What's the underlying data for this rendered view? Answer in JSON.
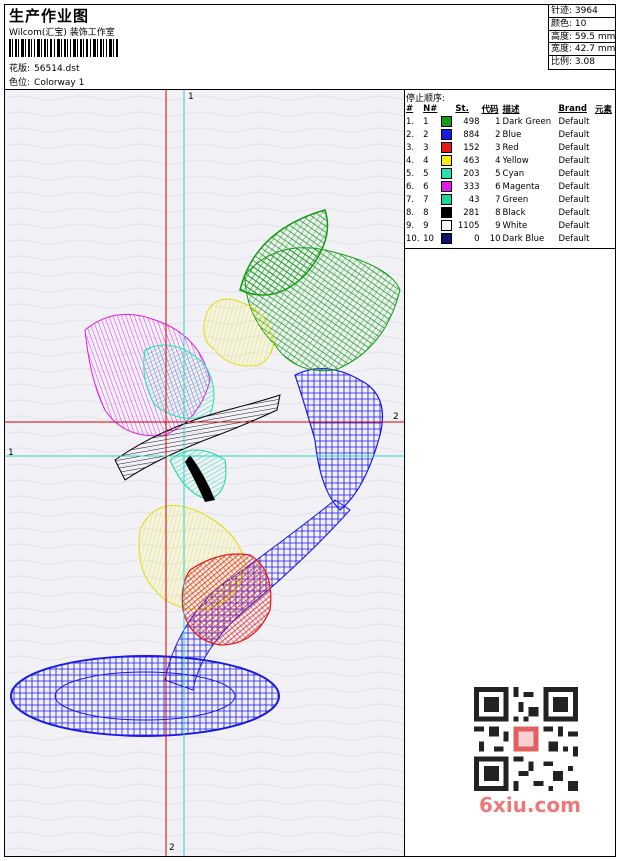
{
  "header": {
    "title": "生产作业图",
    "company": "Wilcom(汇宝) 装饰工作室",
    "design_label": "花版:",
    "design_value": "56514.dst",
    "colorway_label": "色位:",
    "colorway_value": "Colorway 1"
  },
  "stats": [
    {
      "label": "针迹:",
      "value": "3964"
    },
    {
      "label": "颜色:",
      "value": "10"
    },
    {
      "label": "高度:",
      "value": "59.5 mm"
    },
    {
      "label": "宽度:",
      "value": "42.7 mm"
    },
    {
      "label": "比例:",
      "value": "3.08"
    }
  ],
  "axes": {
    "top_marker": "1",
    "left_marker": "1",
    "right_marker": "2",
    "bottom_marker": "2"
  },
  "legend": {
    "title": "停止顺序:",
    "headers": [
      "#",
      "N#",
      "St.",
      "代码",
      "描述",
      "Brand",
      "元素"
    ],
    "rows": [
      {
        "idx": "1.",
        "n": "1",
        "color": "#129e12",
        "st": "498",
        "code": "1",
        "desc": "Dark Green",
        "brand": "Default"
      },
      {
        "idx": "2.",
        "n": "2",
        "color": "#1a1ae8",
        "st": "884",
        "code": "2",
        "desc": "Blue",
        "brand": "Default"
      },
      {
        "idx": "3.",
        "n": "3",
        "color": "#e81818",
        "st": "152",
        "code": "3",
        "desc": "Red",
        "brand": "Default"
      },
      {
        "idx": "4.",
        "n": "4",
        "color": "#f2ee12",
        "st": "463",
        "code": "4",
        "desc": "Yellow",
        "brand": "Default"
      },
      {
        "idx": "5.",
        "n": "5",
        "color": "#22e2b4",
        "st": "203",
        "code": "5",
        "desc": "Cyan",
        "brand": "Default"
      },
      {
        "idx": "6.",
        "n": "6",
        "color": "#e61ae6",
        "st": "333",
        "code": "6",
        "desc": "Magenta",
        "brand": "Default"
      },
      {
        "idx": "7.",
        "n": "7",
        "color": "#1ad89c",
        "st": "43",
        "code": "7",
        "desc": "Green",
        "brand": "Default"
      },
      {
        "idx": "8.",
        "n": "8",
        "color": "#000000",
        "st": "281",
        "code": "8",
        "desc": "Black",
        "brand": "Default"
      },
      {
        "idx": "9.",
        "n": "9",
        "color": "#f4f4f4",
        "st": "1105",
        "code": "9",
        "desc": "White",
        "brand": "Default"
      },
      {
        "idx": "10.",
        "n": "10",
        "color": "#10106e",
        "st": "0",
        "code": "10",
        "desc": "Dark Blue",
        "brand": "Default"
      }
    ]
  },
  "watermark": {
    "text": "6xiu.com",
    "color": "#f07878"
  },
  "colors": {
    "crosshair_red": "#d00000",
    "crosshair_cyan": "#22d8c8",
    "canvas_bg": "#f2f1f6"
  }
}
